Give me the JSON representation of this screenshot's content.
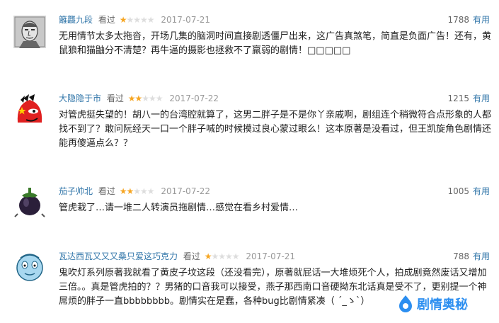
{
  "reviews": [
    {
      "username": "籬龘九段",
      "watched": "看过",
      "rating": 1,
      "date": "2017-07-21",
      "votes": "1788",
      "useful": "有用",
      "comment": "无用情节太多太拖沓，开场几集的脑洞时间直接剧透僵尸出来，这广告真煞笔，简直是负面广告！还有，黄鼠狼和猫鼬分不清楚？再牛逼的摄影也拯救不了羸弱的剧情！□□□□□"
    },
    {
      "username": "大隐隐于市",
      "watched": "看过",
      "rating": 2,
      "date": "2017-07-22",
      "votes": "1215",
      "useful": "有用",
      "comment": "对管虎挺失望的！胡八一的台湾腔就算了，这男二胖子是不是你丫亲戚啊，剧组连个稍微符合点形象的人都找不到了？敢问阮经天一口一个胖子喊的时候摸过良心蒙过眼么！这本原著是没看过，但王凯旋角色剧情还能再傻逼点么？？"
    },
    {
      "username": "茄子帅北",
      "watched": "看过",
      "rating": 2,
      "date": "2017-07-22",
      "votes": "1005",
      "useful": "有用",
      "comment": "管虎栽了…请一堆二人转演员拖剧情…感觉在看乡村爱情…"
    },
    {
      "username": "瓦达西瓦又又又桑只爱这巧克力",
      "watched": "看过",
      "rating": 1,
      "date": "2017-07-21",
      "votes": "788",
      "useful": "有用",
      "comment": "鬼吹灯系列原著我就看了黄皮子坟这段（还没看完），原著就屁话一大堆烦死个人，拍成剧竟然废话又增加三倍。。真是管虎拍的？？男猪的口音我可以接受，燕子那西南口音硬拗东北话真是受不了，更别提一个神屌烦的胖子一直bbbbbbbb。剧情实在是蠢，各种bug比剧情紧凑（ ´_ゝ`）"
    }
  ],
  "watermark": {
    "text": "剧情奥秘",
    "color": "#2b8ef0"
  },
  "colors": {
    "link": "#3377aa",
    "star_on": "#f6a623",
    "star_off": "#dddddd"
  }
}
